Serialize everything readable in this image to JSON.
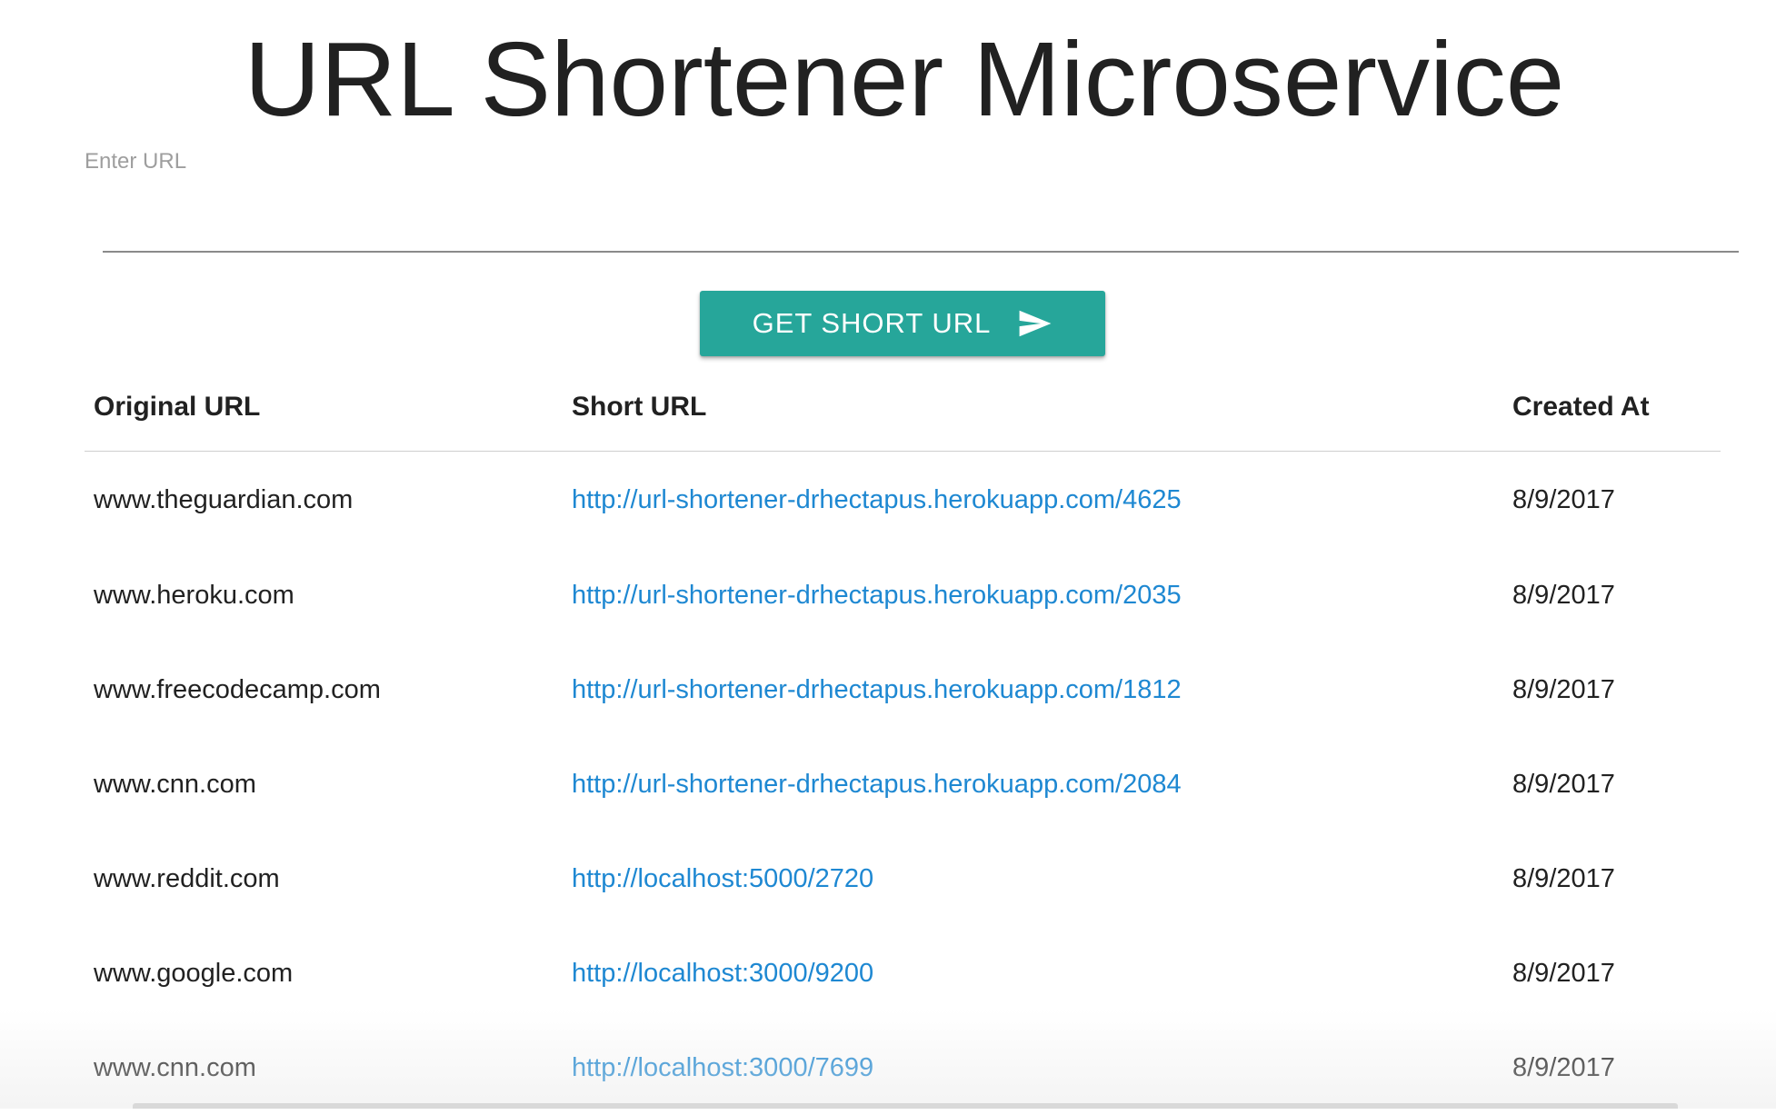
{
  "header": {
    "title": "URL Shortener Microservice"
  },
  "form": {
    "url_label": "Enter URL",
    "url_value": "",
    "submit_label": "GET SHORT URL",
    "submit_icon": "send-icon"
  },
  "table": {
    "headers": {
      "original": "Original URL",
      "short": "Short URL",
      "created": "Created At"
    },
    "rows": [
      {
        "original": "www.theguardian.com",
        "short": "http://url-shortener-drhectapus.herokuapp.com/4625",
        "created": "8/9/2017"
      },
      {
        "original": "www.heroku.com",
        "short": "http://url-shortener-drhectapus.herokuapp.com/2035",
        "created": "8/9/2017"
      },
      {
        "original": "www.freecodecamp.com",
        "short": "http://url-shortener-drhectapus.herokuapp.com/1812",
        "created": "8/9/2017"
      },
      {
        "original": "www.cnn.com",
        "short": "http://url-shortener-drhectapus.herokuapp.com/2084",
        "created": "8/9/2017"
      },
      {
        "original": "www.reddit.com",
        "short": "http://localhost:5000/2720",
        "created": "8/9/2017"
      },
      {
        "original": "www.google.com",
        "short": "http://localhost:3000/9200",
        "created": "8/9/2017"
      },
      {
        "original": "www.cnn.com",
        "short": "http://localhost:3000/7699",
        "created": "8/9/2017"
      }
    ]
  },
  "colors": {
    "accent": "#26a69a",
    "link": "#1e88d2",
    "text": "#212121",
    "label": "#9e9e9e"
  }
}
